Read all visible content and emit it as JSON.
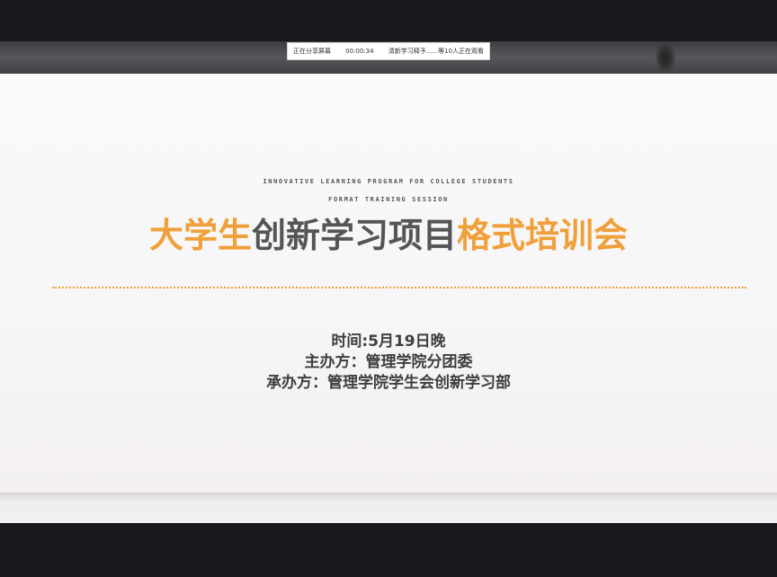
{
  "share_bar": {
    "status": "正在分享屏幕",
    "timer": "00:00:34",
    "viewers": "清新学习释予......等10人正在观看"
  },
  "slide": {
    "subtitle_en_1": "INNOVATIVE LEARNING PROGRAM FOR COLLEGE STUDENTS",
    "subtitle_en_2": "FORMAT TRAINING SESSION",
    "title_part_1": "大学生",
    "title_part_2": "创新学习项目",
    "title_part_3": "格式培训会",
    "time_line": "时间:5月19日晚",
    "host_line": "主办方：管理学院分团委",
    "organizer_line": "承办方：管理学院学生会创新学习部"
  },
  "colors": {
    "accent_orange": "#f0a03a",
    "title_gray": "#555558",
    "body_text": "#3e3e40",
    "frame_dark": "#17191c"
  }
}
